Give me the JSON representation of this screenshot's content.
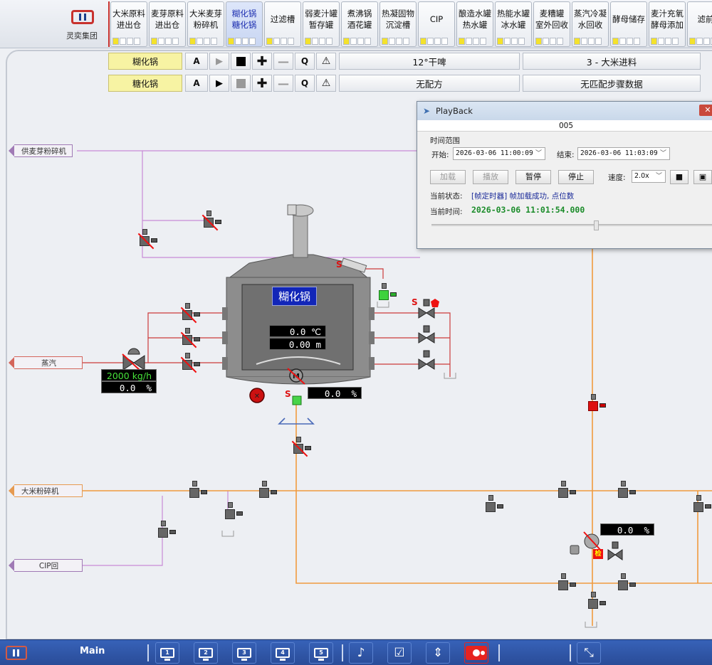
{
  "brand": {
    "name": "灵奕集团"
  },
  "tabs": [
    {
      "l1": "大米原料",
      "l2": "进出仓",
      "active": false
    },
    {
      "l1": "麦芽原料",
      "l2": "进出仓",
      "active": false
    },
    {
      "l1": "大米麦芽",
      "l2": "粉碎机",
      "active": false
    },
    {
      "l1": "糊化锅",
      "l2": "糖化锅",
      "active": true
    },
    {
      "l1": "过滤槽",
      "l2": "",
      "active": false
    },
    {
      "l1": "弱麦汁罐",
      "l2": "暂存罐",
      "active": false
    },
    {
      "l1": "煮沸锅",
      "l2": "酒花罐",
      "active": false
    },
    {
      "l1": "热凝固物",
      "l2": "沉淀槽",
      "active": false
    },
    {
      "l1": "CIP",
      "l2": "",
      "active": false
    },
    {
      "l1": "酿造水罐",
      "l2": "热水罐",
      "active": false
    },
    {
      "l1": "热能水罐",
      "l2": "冰水罐",
      "active": false
    },
    {
      "l1": "麦糟罐",
      "l2": "室外回收",
      "active": false
    },
    {
      "l1": "蒸汽冷凝",
      "l2": "水回收",
      "active": false
    },
    {
      "l1": "酵母储存",
      "l2": "",
      "active": false
    },
    {
      "l1": "麦汁充氧",
      "l2": "酵母添加",
      "active": false
    },
    {
      "l1": "滤前",
      "l2": "",
      "active": false
    }
  ],
  "control_rows": [
    {
      "vessel": "糊化锅",
      "auto": "A",
      "q": "Q",
      "recipe": "12°干啤",
      "step": "3 - 大米进料"
    },
    {
      "vessel": "糖化锅",
      "auto": "A",
      "q": "Q",
      "recipe": "无配方",
      "step": "无匹配步骤数据"
    }
  ],
  "sources": {
    "malt_mill": "供麦芽粉碎机",
    "steam": "蒸汽",
    "rice_mill": "大米粉碎机",
    "cip_return": "CIP回"
  },
  "vessel": {
    "name": "糊化锅",
    "temperature": "0.0",
    "temperature_unit": "℃",
    "level": "0.00",
    "level_unit": "m",
    "motor_label": "M",
    "agitator_speed": "0.0",
    "agitator_unit": "%"
  },
  "steam_flow": {
    "value": "2000",
    "unit": "kg/h",
    "valve_open": "0.0",
    "valve_unit": "%"
  },
  "right_valve": {
    "value": "0.0",
    "unit": "%",
    "check_label": "检"
  },
  "s_marker": "S",
  "playback": {
    "title": "PlayBack",
    "id": "005",
    "range_label": "时间范围",
    "start_label": "开始:",
    "start_value": "2026-03-06 11:00:09",
    "end_label": "结束:",
    "end_value": "2026-03-06 11:03:09",
    "buttons": [
      "加载",
      "播放",
      "暂停",
      "停止"
    ],
    "speed_label": "速度:",
    "speed_value": "2.0x",
    "status_label": "当前状态:",
    "status_value": "[帧定时器] 帧加载成功, 点位数",
    "time_label": "当前时间:",
    "time_value": "2026-03-06 11:01:54.000",
    "slider_fraction": 0.58
  },
  "bottom_nav": {
    "main_label": "Main",
    "screens": [
      "1",
      "2",
      "3",
      "4",
      "5"
    ]
  },
  "colors": {
    "steam_pipe": "#cc3a3a",
    "product_pipe": "#f09a3e",
    "cip_pipe": "#c98ad6",
    "vessel_badge": "#1226b8",
    "active_tab_text": "#1d2fb0"
  }
}
